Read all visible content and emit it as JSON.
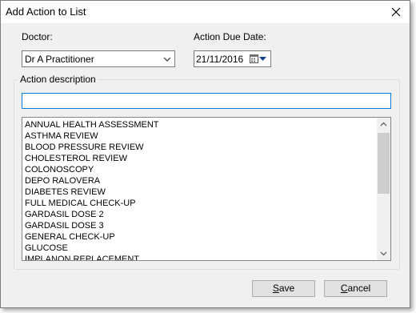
{
  "window": {
    "title": "Add Action to List"
  },
  "doctor": {
    "label": "Doctor:",
    "selected": "Dr A Practitioner"
  },
  "due_date": {
    "label": "Action Due Date:",
    "value": "21/11/2016"
  },
  "action_description": {
    "label": "Action description",
    "input_value": "",
    "items": [
      "ANNUAL HEALTH ASSESSMENT",
      "ASTHMA REVIEW",
      "BLOOD PRESSURE REVIEW",
      "CHOLESTEROL REVIEW",
      "COLONOSCOPY",
      "DEPO RALOVERA",
      "DIABETES REVIEW",
      "FULL MEDICAL CHECK-UP",
      "GARDASIL DOSE 2",
      "GARDASIL DOSE 3",
      "GENERAL CHECK-UP",
      "GLUCOSE",
      "IMPLANON REPLACEMENT"
    ]
  },
  "buttons": {
    "save": {
      "first": "S",
      "rest": "ave"
    },
    "cancel": {
      "first": "C",
      "rest": "ancel"
    }
  },
  "icons": {
    "close": "close-icon",
    "dropdown": "chevron-down-icon",
    "calendar": "calendar-icon"
  }
}
